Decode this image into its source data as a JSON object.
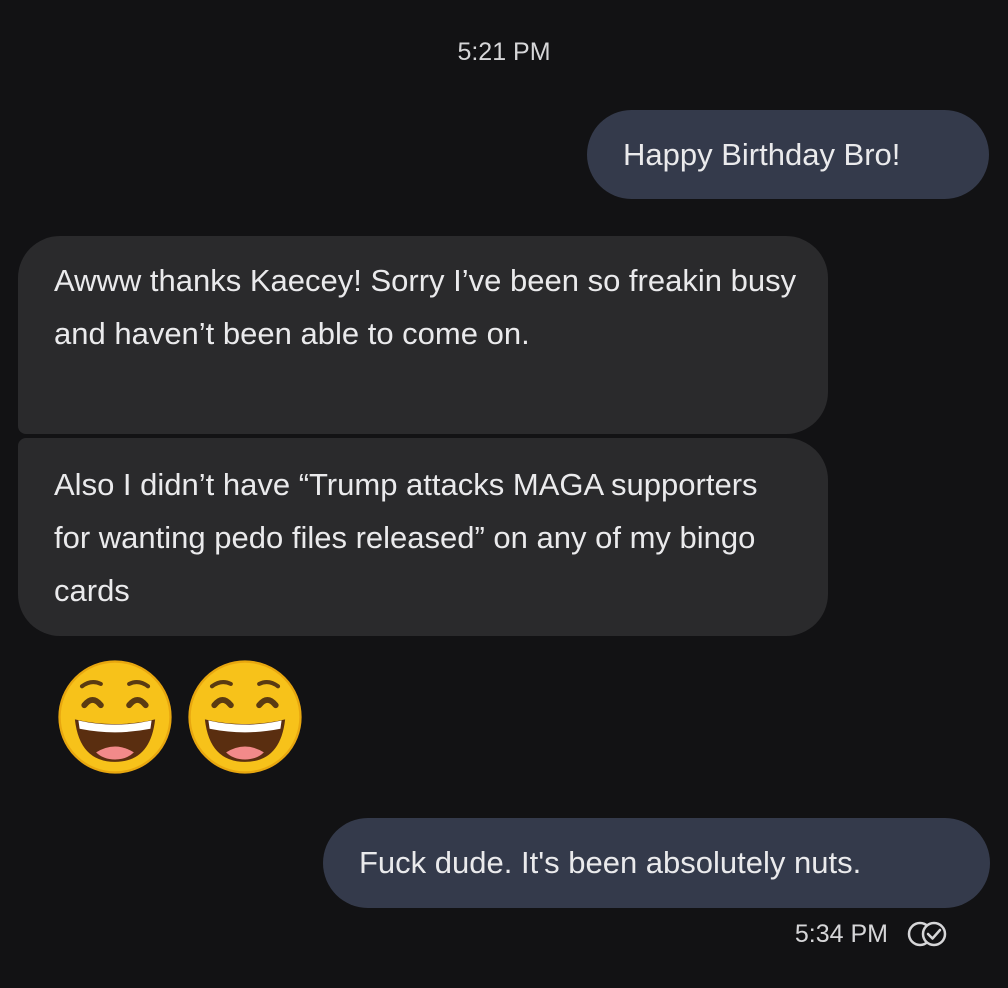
{
  "conversation": {
    "timestamp_top": "5:21 PM",
    "messages": [
      {
        "direction": "outgoing",
        "text": "Happy Birthday Bro!"
      },
      {
        "direction": "incoming",
        "text": "Awww thanks Kaecey! Sorry I’ve been so freakin busy and haven’t been able to come on."
      },
      {
        "direction": "incoming",
        "text": "Also I didn’t have “Trump attacks MAGA supporters for wanting pedo files released” on any of my bingo cards"
      },
      {
        "direction": "incoming",
        "emoji": [
          "smiling-face-with-open-mouth-and-smiling-eyes",
          "smiling-face-with-open-mouth-and-smiling-eyes"
        ]
      },
      {
        "direction": "outgoing",
        "text": "Fuck dude. It's been absolutely nuts."
      }
    ],
    "timestamp_bottom": "5:34 PM",
    "status_icon": "read-receipt-icon"
  },
  "colors": {
    "background": "#121214",
    "outgoing_bubble": "#343a4b",
    "incoming_bubble": "#2a2a2c",
    "text": "#eaeaec"
  }
}
